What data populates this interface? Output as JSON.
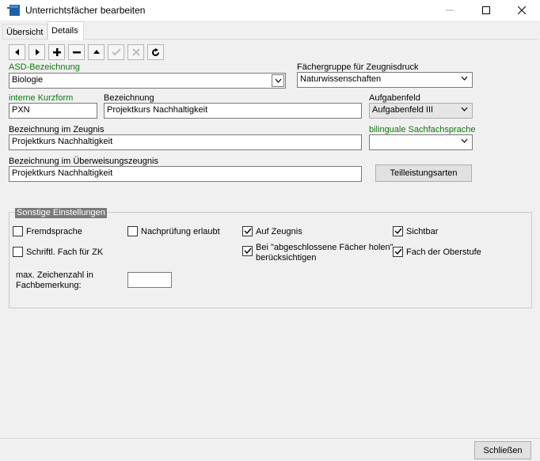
{
  "window": {
    "title": "Unterrichtsfächer bearbeiten"
  },
  "tabs": [
    {
      "label": "Übersicht"
    },
    {
      "label": "Details"
    }
  ],
  "toolbar": [
    "arrow-left-icon",
    "arrow-right-icon",
    "plus-icon",
    "minus-icon",
    "arrow-up-icon",
    "check-icon",
    "cancel-icon",
    "refresh-icon"
  ],
  "form": {
    "asd": {
      "label": "ASD-Bezeichnung",
      "value": "Biologie"
    },
    "faechergruppe": {
      "label": "Fächergruppe für Zeugnisdruck",
      "value": "Naturwissenschaften"
    },
    "kurzform": {
      "label": "interne Kurzform",
      "value": "PXN"
    },
    "bezeichnung": {
      "label": "Bezeichnung",
      "value": "Projektkurs Nachhaltigkeit"
    },
    "aufgabenfeld": {
      "label": "Aufgabenfeld",
      "value": "Aufgabenfeld III"
    },
    "zeugnis": {
      "label": "Bezeichnung im Zeugnis",
      "value": "Projektkurs Nachhaltigkeit"
    },
    "bilingual": {
      "label": "bilinguale Sachfachsprache",
      "value": ""
    },
    "ueberweisung": {
      "label": "Bezeichnung im Überweisungszeugnis",
      "value": "Projektkurs Nachhaltigkeit"
    },
    "teilleistung_button": "Teilleistungsarten"
  },
  "sonstige": {
    "title": "Sonstige Einstellungen",
    "fremdsprache": {
      "label": "Fremdsprache",
      "checked": false
    },
    "nachpruefung": {
      "label": "Nachprüfung erlaubt",
      "checked": false
    },
    "auf_zeugnis": {
      "label": "Auf Zeugnis",
      "checked": true
    },
    "sichtbar": {
      "label": "Sichtbar",
      "checked": true
    },
    "schriftl": {
      "label": "Schriftl. Fach für ZK",
      "checked": false
    },
    "abgeschlossen": {
      "label_line1": "Bei \"abgeschlossene Fächer holen\"",
      "label_line2": "berücksichtigen",
      "checked": true
    },
    "oberstufe": {
      "label": "Fach der Oberstufe",
      "checked": true
    },
    "max_zeichen": {
      "label_line1": "max. Zeichenzahl in",
      "label_line2": "Fachbemerkung:",
      "value": ""
    }
  },
  "footer": {
    "close_button": "Schließen"
  }
}
